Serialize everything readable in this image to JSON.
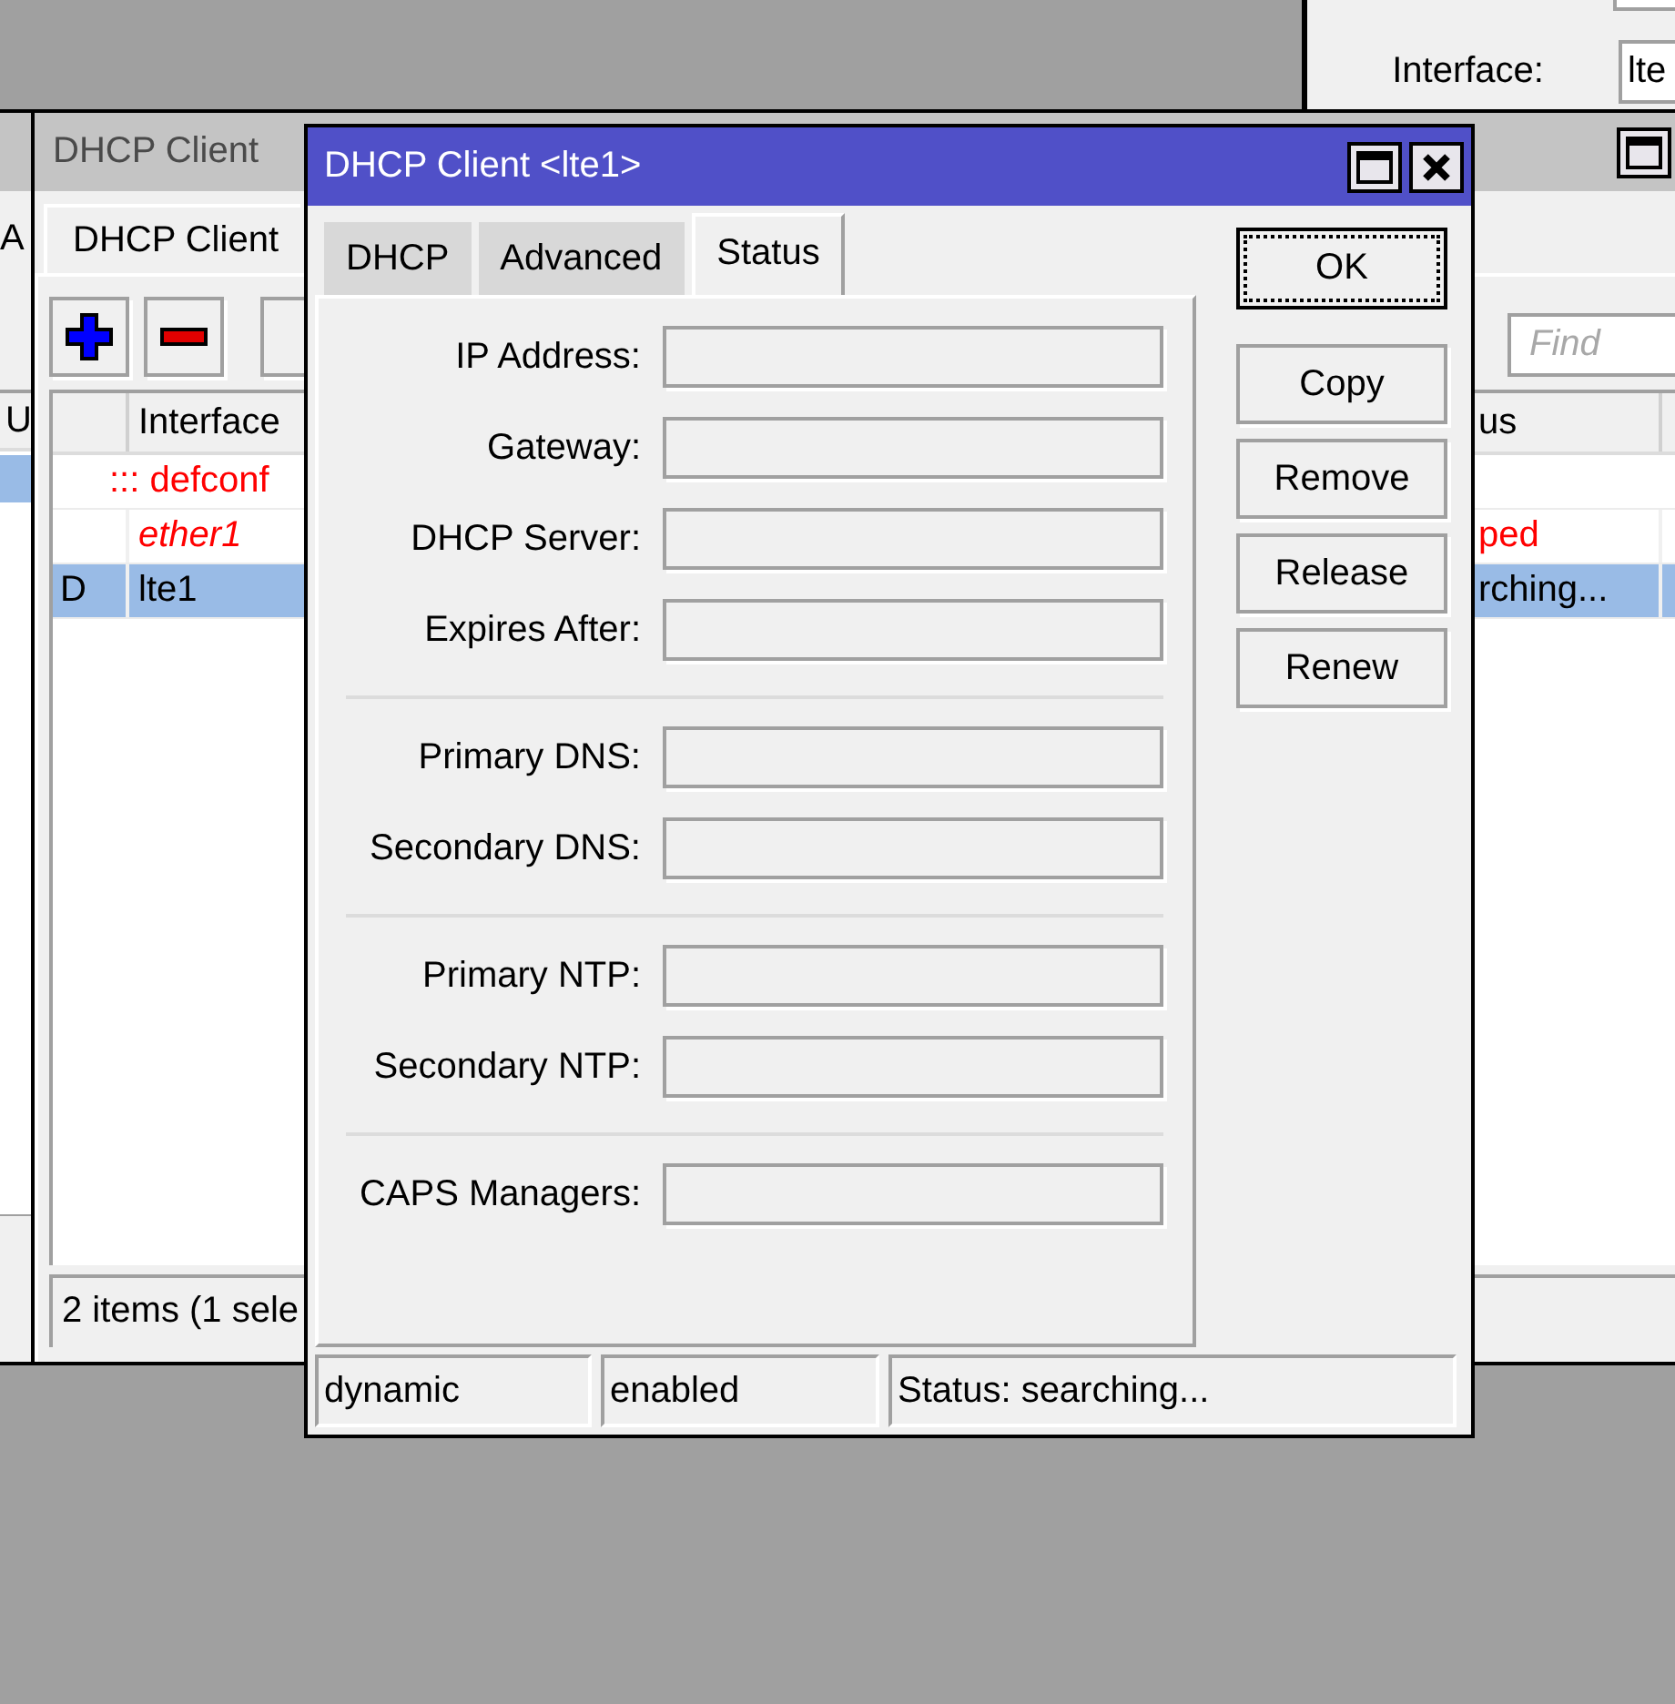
{
  "interface_window": {
    "field_label": "Interface:",
    "field_value": "lte"
  },
  "left_window": {
    "tab": "A",
    "column": "U",
    "rows": [
      {
        "selected": true
      }
    ]
  },
  "dhcp_client_window": {
    "title": "DHCP Client",
    "active": false,
    "tabs": [
      {
        "label": "DHCP Client",
        "selected": true
      }
    ],
    "toolbar": [
      {
        "kind": "add"
      },
      {
        "kind": "remove"
      },
      {
        "kind": "covered"
      }
    ],
    "search": {
      "placeholder": "Find"
    },
    "table": {
      "columns": [
        "Interface",
        "us"
      ],
      "rows": [
        {
          "kind": "comment",
          "text": "::: defconf"
        },
        {
          "kind": "item",
          "interface": "ether1",
          "status": "ped",
          "invalid": true,
          "selected": false
        },
        {
          "kind": "item",
          "flag": "D",
          "interface": "lte1",
          "status": "rching...",
          "invalid": false,
          "selected": true
        }
      ]
    },
    "status_bar": "2 items (1 sele"
  },
  "dialog": {
    "title": "DHCP Client <lte1>",
    "active": true,
    "tabs": [
      {
        "label": "DHCP",
        "selected": false
      },
      {
        "label": "Advanced",
        "selected": false
      },
      {
        "label": "Status",
        "selected": true
      }
    ],
    "field_groups": [
      {
        "fields": [
          {
            "label": "IP Address:"
          },
          {
            "label": "Gateway:"
          },
          {
            "label": "DHCP Server:"
          },
          {
            "label": "Expires After:"
          }
        ]
      },
      {
        "fields": [
          {
            "label": "Primary DNS:"
          },
          {
            "label": "Secondary DNS:"
          }
        ]
      },
      {
        "fields": [
          {
            "label": "Primary NTP:"
          },
          {
            "label": "Secondary NTP:"
          }
        ]
      },
      {
        "fields": [
          {
            "label": "CAPS Managers:"
          }
        ]
      }
    ],
    "buttons": [
      {
        "label": "OK",
        "focused": true
      },
      {
        "label": "Copy",
        "focused": false
      },
      {
        "label": "Remove",
        "focused": false
      },
      {
        "label": "Release",
        "focused": false
      },
      {
        "label": "Renew",
        "focused": false
      }
    ],
    "status_bar": [
      "dynamic",
      "enabled",
      "Status: searching..."
    ]
  }
}
